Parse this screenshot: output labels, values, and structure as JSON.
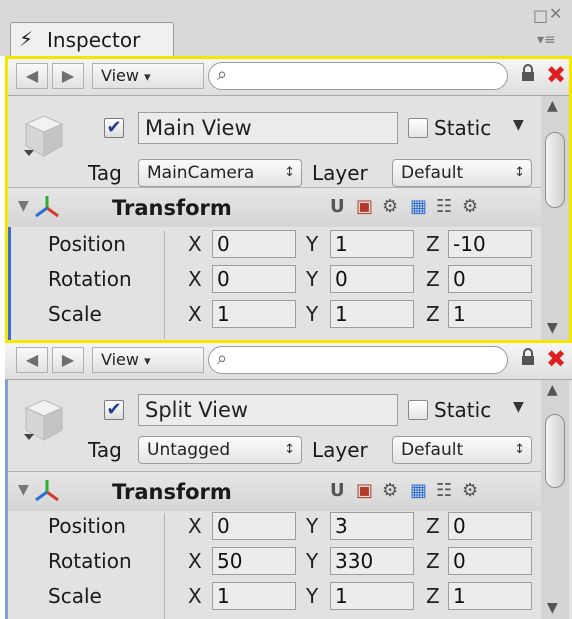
{
  "window": {
    "tab_icon": "inspector-bolt-icon",
    "tab_label": "Inspector",
    "restore_glyph": "□",
    "close_glyph": "✕",
    "menu_glyph": "▾≡"
  },
  "toolbar": {
    "back_glyph": "◀",
    "forward_glyph": "▶",
    "view_label": "View",
    "view_arrow": "▾",
    "search_glyph": "⌕",
    "lock_glyph": "🔒",
    "close_glyph": "✖"
  },
  "labels": {
    "static": "Static",
    "tag": "Tag",
    "layer": "Layer",
    "position": "Position",
    "rotation": "Rotation",
    "scale": "Scale",
    "x": "X",
    "y": "Y",
    "z": "Z",
    "transform": "Transform",
    "dropdown_arrows": "↕",
    "static_arrow": "▼",
    "foldout_arrow": "▼",
    "checkmark": "✔"
  },
  "panels": [
    {
      "name": "Main View",
      "active": true,
      "static": false,
      "tag": "MainCamera",
      "layer": "Default",
      "position": [
        "0",
        "1",
        "-10"
      ],
      "rotation": [
        "0",
        "0",
        "0"
      ],
      "scale": [
        "1",
        "1",
        "1"
      ]
    },
    {
      "name": "Split View",
      "active": true,
      "static": false,
      "tag": "Untagged",
      "layer": "Default",
      "position": [
        "0",
        "3",
        "0"
      ],
      "rotation": [
        "50",
        "330",
        "0"
      ],
      "scale": [
        "1",
        "1",
        "1"
      ]
    }
  ],
  "colors": {
    "focus_outline": "#f7e600",
    "close_red": "#e02020",
    "panel_bg": "#e2e2e2"
  }
}
